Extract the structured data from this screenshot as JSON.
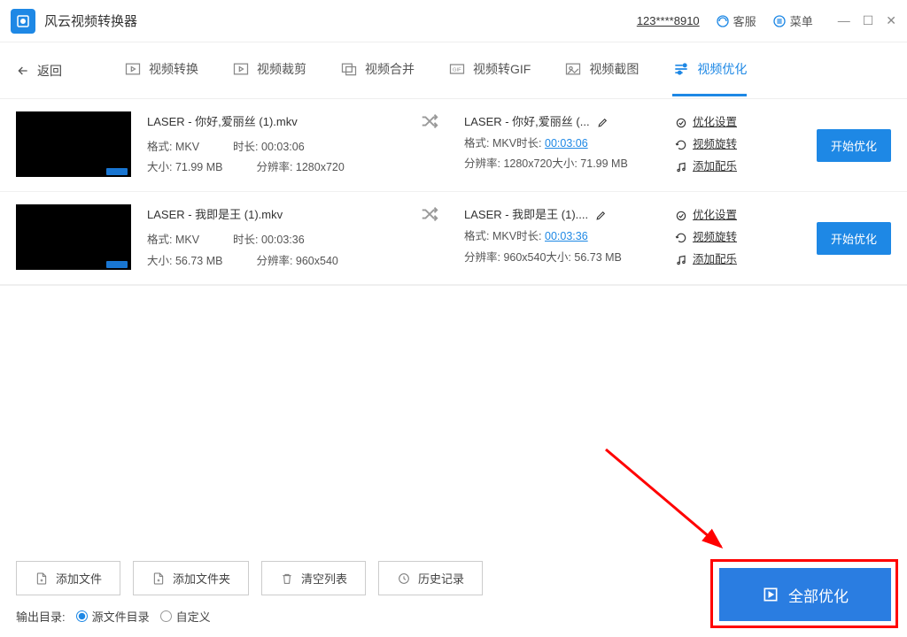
{
  "header": {
    "appTitle": "风云视频转换器",
    "account": "123****8910",
    "support": "客服",
    "menu": "菜单"
  },
  "toolbar": {
    "back": "返回",
    "tabs": [
      "视频转换",
      "视频裁剪",
      "视频合并",
      "视频转GIF",
      "视频截图",
      "视频优化"
    ]
  },
  "files": [
    {
      "name": "LASER - 你好,爱丽丝 (1).mkv",
      "fmtLabel": "格式: MKV",
      "durLabel": "时长: 00:03:06",
      "sizeLabel": "大小: 71.99 MB",
      "resLabel": "分辨率: 1280x720",
      "out": {
        "name": "LASER - 你好,爱丽丝 (...",
        "fmtLabel": "格式: MKV",
        "durLabel": "时长: ",
        "durValue": "00:03:06",
        "resLabel": "分辨率: 1280x720",
        "sizeLabel": "大小: 71.99 MB"
      }
    },
    {
      "name": "LASER - 我即是王 (1).mkv",
      "fmtLabel": "格式: MKV",
      "durLabel": "时长: 00:03:36",
      "sizeLabel": "大小: 56.73 MB",
      "resLabel": "分辨率: 960x540",
      "out": {
        "name": "LASER - 我即是王 (1)....",
        "fmtLabel": "格式: MKV",
        "durLabel": "时长: ",
        "durValue": "00:03:36",
        "resLabel": "分辨率: 960x540",
        "sizeLabel": "大小: 56.73 MB"
      }
    }
  ],
  "rowActions": {
    "opt": "优化设置",
    "rot": "视频旋转",
    "music": "添加配乐",
    "start": "开始优化"
  },
  "bottom": {
    "addFile": "添加文件",
    "addFolder": "添加文件夹",
    "clear": "清空列表",
    "history": "历史记录",
    "outLabel": "输出目录:",
    "srcDir": "源文件目录",
    "custom": "自定义",
    "allBtn": "全部优化"
  }
}
